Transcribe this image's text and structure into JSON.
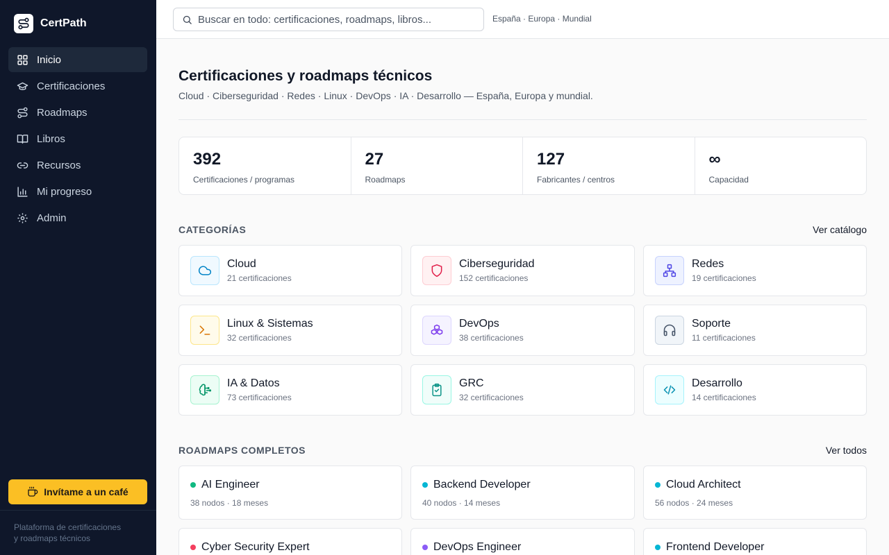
{
  "app": {
    "name": "CertPath"
  },
  "nav": [
    {
      "label": "Inicio",
      "icon": "grid-icon",
      "active": true
    },
    {
      "label": "Certificaciones",
      "icon": "graduation-cap-icon"
    },
    {
      "label": "Roadmaps",
      "icon": "route-icon"
    },
    {
      "label": "Libros",
      "icon": "book-icon"
    },
    {
      "label": "Recursos",
      "icon": "link-icon"
    },
    {
      "label": "Mi progreso",
      "icon": "bar-chart-icon"
    },
    {
      "label": "Admin",
      "icon": "gear-icon"
    }
  ],
  "coffee": {
    "label": "Invítame a un café",
    "icon": "coffee-icon",
    "color": "#fbbf24"
  },
  "sidebar_footer": {
    "line1": "Plataforma de certificaciones",
    "line2": "y roadmaps técnicos"
  },
  "search": {
    "placeholder": "Buscar en todo: certificaciones, roadmaps, libros...",
    "value": ""
  },
  "region": "España · Europa · Mundial",
  "page": {
    "title": "Certificaciones y roadmaps técnicos",
    "subtitle": "Cloud · Ciberseguridad · Redes · Linux · DevOps · IA · Desarrollo — España, Europa y mundial."
  },
  "stats": [
    {
      "value": "392",
      "label": "Certificaciones / programas"
    },
    {
      "value": "27",
      "label": "Roadmaps"
    },
    {
      "value": "127",
      "label": "Fabricantes / centros"
    },
    {
      "value": "∞",
      "label": "Capacidad"
    }
  ],
  "categories_section": {
    "label": "CATEGORÍAS",
    "link": "Ver catálogo"
  },
  "categories": [
    {
      "name": "Cloud",
      "count": "21 certificaciones",
      "icon": "cloud-icon",
      "color": "#0284c7",
      "bg": "#f0f9ff",
      "border": "#bae6fd"
    },
    {
      "name": "Ciberseguridad",
      "count": "152 certificaciones",
      "icon": "shield-icon",
      "color": "#e11d48",
      "bg": "#fff1f2",
      "border": "#fecdd3"
    },
    {
      "name": "Redes",
      "count": "19 certificaciones",
      "icon": "network-icon",
      "color": "#4f46e5",
      "bg": "#eef2ff",
      "border": "#c7d2fe"
    },
    {
      "name": "Linux & Sistemas",
      "count": "32 certificaciones",
      "icon": "terminal-icon",
      "color": "#d97706",
      "bg": "#fffbeb",
      "border": "#fde68a"
    },
    {
      "name": "DevOps",
      "count": "38 certificaciones",
      "icon": "boxes-icon",
      "color": "#7c3aed",
      "bg": "#f5f3ff",
      "border": "#ddd6fe"
    },
    {
      "name": "Soporte",
      "count": "11 certificaciones",
      "icon": "headphones-icon",
      "color": "#475569",
      "bg": "#f1f5f9",
      "border": "#cbd5e1"
    },
    {
      "name": "IA & Datos",
      "count": "73 certificaciones",
      "icon": "brain-icon",
      "color": "#059669",
      "bg": "#ecfdf5",
      "border": "#a7f3d0"
    },
    {
      "name": "GRC",
      "count": "32 certificaciones",
      "icon": "clipboard-check-icon",
      "color": "#0d9488",
      "bg": "#f0fdfa",
      "border": "#99f6e4"
    },
    {
      "name": "Desarrollo",
      "count": "14 certificaciones",
      "icon": "code-icon",
      "color": "#0891b2",
      "bg": "#ecfeff",
      "border": "#a5f3fc"
    }
  ],
  "roadmaps_section": {
    "label": "ROADMAPS COMPLETOS",
    "link": "Ver todos"
  },
  "roadmaps": [
    {
      "name": "AI Engineer",
      "meta": "38 nodos · 18 meses",
      "color": "#10b981"
    },
    {
      "name": "Backend Developer",
      "meta": "40 nodos · 14 meses",
      "color": "#06b6d4"
    },
    {
      "name": "Cloud Architect",
      "meta": "56 nodos · 24 meses",
      "color": "#06b6d4"
    },
    {
      "name": "Cyber Security Expert",
      "meta": "",
      "color": "#f43f5e"
    },
    {
      "name": "DevOps Engineer",
      "meta": "",
      "color": "#8b5cf6"
    },
    {
      "name": "Frontend Developer",
      "meta": "",
      "color": "#06b6d4"
    }
  ]
}
